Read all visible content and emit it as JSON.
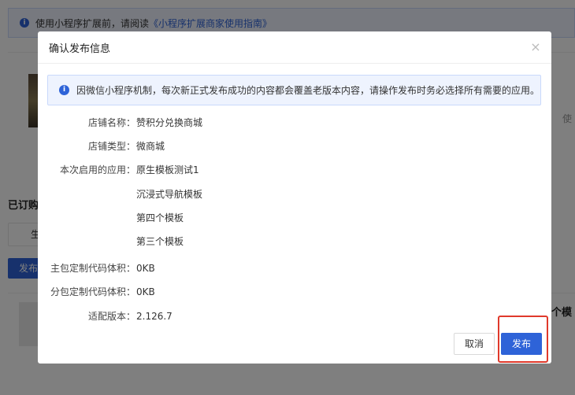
{
  "background": {
    "notice_text": "使用小程序扩展前，请阅读",
    "notice_link": "《小程序扩展商家使用指南》",
    "right_text": "使",
    "section_title": "已订购",
    "tab_label": "生",
    "publish_label": "发布",
    "right_title": "个模"
  },
  "modal": {
    "title": "确认发布信息",
    "close_glyph": "×",
    "alert_text": "因微信小程序机制，每次新正式发布成功的内容都会覆盖老版本内容，请操作发布时务必选择所有需要的应用。",
    "fields": {
      "store_name_label": "店铺名称：",
      "store_name_value": "赞积分兑换商城",
      "store_type_label": "店铺类型：",
      "store_type_value": "微商城",
      "apps_label": "本次启用的应用：",
      "apps": [
        "原生模板测试1",
        "沉浸式导航模板",
        "第四个模板",
        "第三个模板"
      ],
      "main_pkg_label": "主包定制代码体积：",
      "main_pkg_value": "0KB",
      "sub_pkg_label": "分包定制代码体积：",
      "sub_pkg_value": "0KB",
      "version_label": "适配版本：",
      "version_value": "2.126.7"
    },
    "cancel_label": "取消",
    "publish_label": "发布"
  },
  "colors": {
    "accent": "#2e63d8",
    "alert_bg": "#eef3fe",
    "highlight": "#e0392b"
  },
  "icons": {
    "info": "info-icon",
    "close": "close-icon"
  }
}
